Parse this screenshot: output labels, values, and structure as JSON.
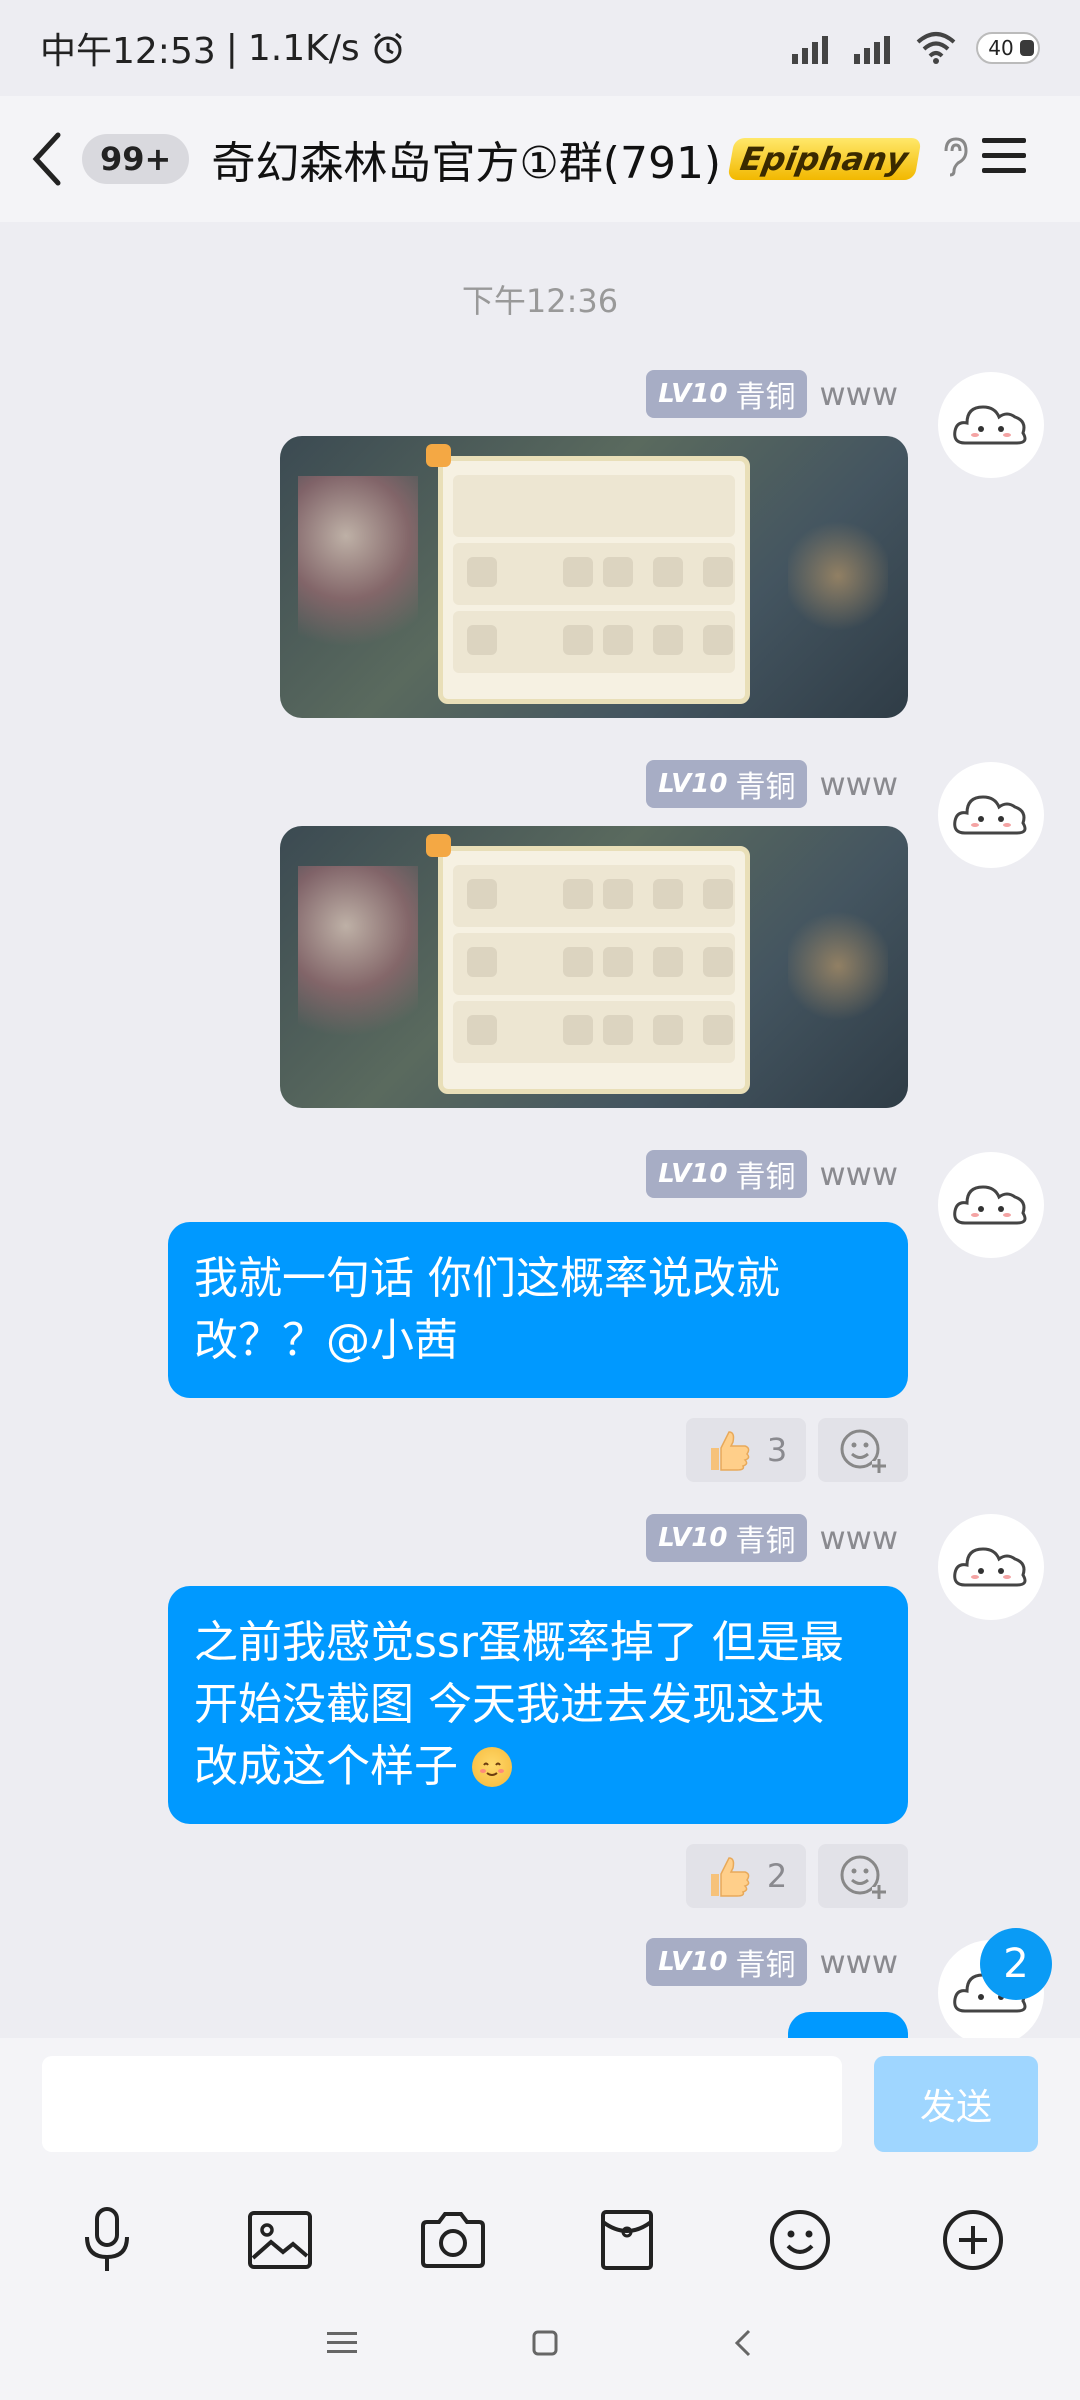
{
  "status_bar": {
    "time": "中午12:53",
    "speed": "1.1K/s",
    "battery": "40"
  },
  "header": {
    "unread": "99+",
    "title": "奇幻森林岛官方①群(791)",
    "title_badge": "Epiphany"
  },
  "timestamp": "下午12:36",
  "sender": {
    "level": "LV10",
    "rank": "青铜",
    "name": "www"
  },
  "messages": [
    {
      "type": "image"
    },
    {
      "type": "image"
    },
    {
      "type": "text",
      "text_line1": "我就一句话 你们这概率说改就",
      "text_line2": "改？？@小茜",
      "reaction_count": "3"
    },
    {
      "type": "text",
      "text_line1": "之前我感觉ssr蛋概率掉了 但是最",
      "text_line2": "开始没截图 今天我进去发现这块",
      "text_line3": "改成这个样子",
      "reaction_count": "2"
    }
  ],
  "new_messages_badge": "2",
  "input": {
    "send_label": "发送"
  },
  "colors": {
    "bubble": "#0099ff",
    "send_disabled": "#9fd6ff",
    "background": "#ededf2"
  },
  "icons": [
    "back-icon",
    "ear-icon",
    "menu-icon",
    "alarm-icon",
    "signal-icon",
    "wifi-icon",
    "thumbs-up-icon",
    "add-reaction-icon",
    "mic-icon",
    "image-icon",
    "camera-icon",
    "red-packet-icon",
    "emoji-icon",
    "plus-icon"
  ]
}
